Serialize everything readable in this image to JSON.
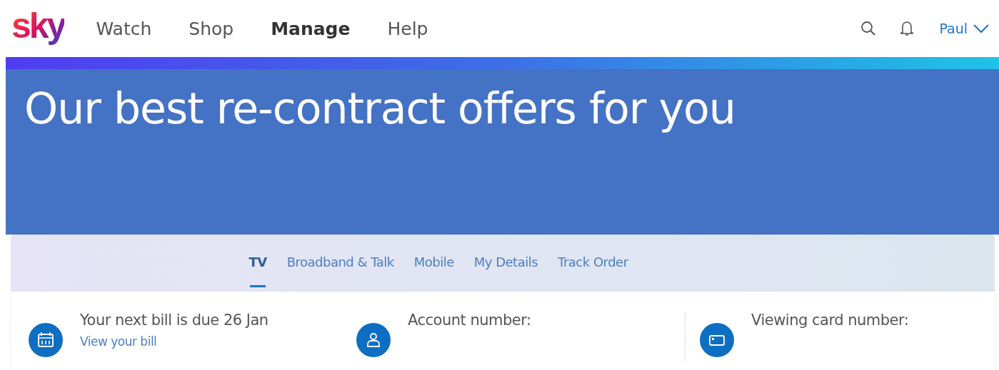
{
  "header": {
    "logo": "sky",
    "nav": [
      {
        "label": "Watch",
        "selected": false
      },
      {
        "label": "Shop",
        "selected": false
      },
      {
        "label": "Manage",
        "selected": true
      },
      {
        "label": "Help",
        "selected": false
      }
    ],
    "user": "Paul"
  },
  "banner": {
    "title": "Our best re-contract offers for you"
  },
  "tabs": [
    {
      "label": "TV",
      "selected": true
    },
    {
      "label": "Broadband & Talk",
      "selected": false
    },
    {
      "label": "Mobile",
      "selected": false
    },
    {
      "label": "My Details",
      "selected": false
    },
    {
      "label": "Track Order",
      "selected": false
    }
  ],
  "summary": [
    {
      "title": "Your next bill is due 26 Jan",
      "link": "View your bill"
    },
    {
      "title": "Account number:"
    },
    {
      "title": "Viewing card number:"
    }
  ]
}
